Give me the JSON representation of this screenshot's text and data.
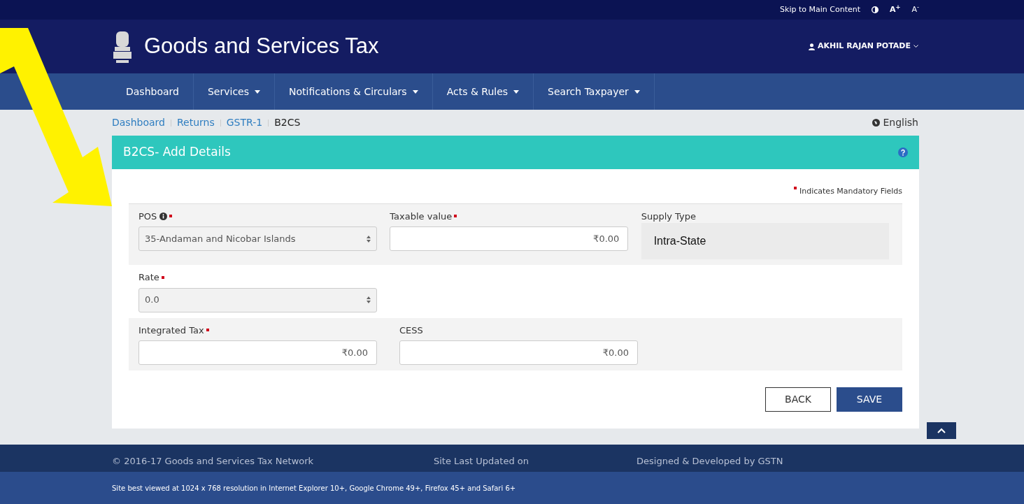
{
  "top_bar": {
    "skip_link": "Skip to Main Content",
    "font_increase": "A$^{+}$",
    "font_decrease": "A$^{-}$"
  },
  "header": {
    "title": "Goods and Services Tax",
    "user": "AKHIL RAJAN POTADE"
  },
  "nav": [
    {
      "label": "Dashboard",
      "dropdown": false
    },
    {
      "label": "Services",
      "dropdown": true
    },
    {
      "label": "Notifications & Circulars",
      "dropdown": true
    },
    {
      "label": "Acts & Rules",
      "dropdown": true
    },
    {
      "label": "Search Taxpayer",
      "dropdown": true
    }
  ],
  "breadcrumb": [
    {
      "label": "Dashboard",
      "current": false
    },
    {
      "label": "Returns",
      "current": false
    },
    {
      "label": "GSTR-1",
      "current": false
    },
    {
      "label": "B2CS",
      "current": true
    }
  ],
  "language": "English",
  "card": {
    "title": "B2CS- Add Details",
    "mandatory_note": "Indicates Mandatory Fields",
    "rows": [
      {
        "shaded": true,
        "fields": [
          {
            "kind": "select",
            "label": "POS",
            "info": true,
            "required": true,
            "value": "35-Andaman and Nicobar Islands"
          },
          {
            "kind": "input",
            "label": "Taxable value",
            "info": false,
            "required": true,
            "value": "₹0.00"
          },
          {
            "kind": "readonly",
            "label": "Supply Type",
            "info": false,
            "required": false,
            "value": "Intra-State"
          }
        ]
      },
      {
        "shaded": false,
        "fields": [
          {
            "kind": "select",
            "label": "Rate",
            "info": false,
            "required": true,
            "value": "0.0"
          }
        ]
      },
      {
        "shaded": true,
        "fields": [
          {
            "kind": "input",
            "label": "Integrated Tax",
            "info": false,
            "required": true,
            "value": "₹0.00"
          },
          {
            "kind": "input",
            "label": "CESS",
            "info": false,
            "required": false,
            "value": "₹0.00"
          }
        ]
      }
    ],
    "buttons": [
      {
        "label": "BACK",
        "kind": "outline"
      },
      {
        "label": "SAVE",
        "kind": "primary"
      }
    ]
  },
  "footer": {
    "copyright": "© 2016-17 Goods and Services Tax Network",
    "updated": "Site Last Updated on",
    "credits": "Designed & Developed by GSTN",
    "note": "Site best viewed at 1024 x 768 resolution in Internet Explorer 10+, Google Chrome 49+, Firefox 45+ and Safari 6+"
  }
}
